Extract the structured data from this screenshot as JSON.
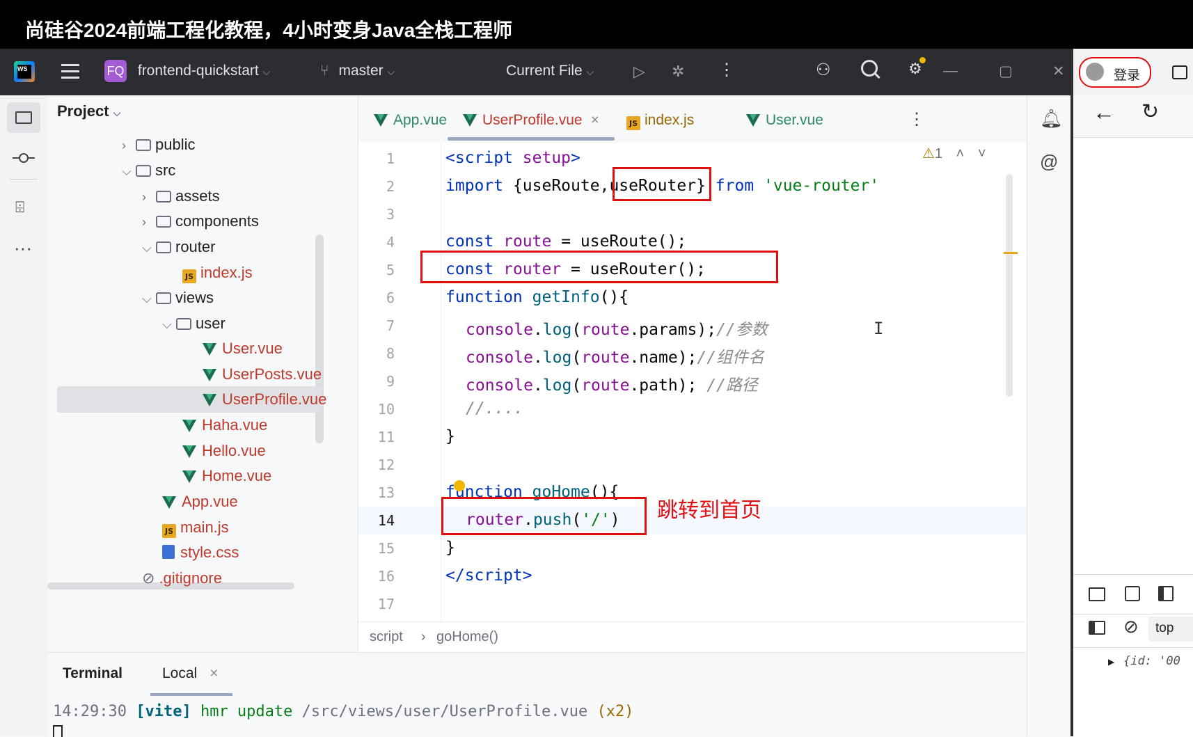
{
  "banner": {
    "title": "尚硅谷2024前端工程化教程，4小时变身Java全栈工程师"
  },
  "toolbar": {
    "project_badge": "FQ",
    "project_name": "frontend-quickstart",
    "branch": "master",
    "run_config": "Current File"
  },
  "project_panel": {
    "title": "Project",
    "tree": [
      {
        "label": "public",
        "kind": "folder",
        "expanded": false
      },
      {
        "label": "src",
        "kind": "folder",
        "expanded": true
      },
      {
        "label": "assets",
        "kind": "folder",
        "expanded": false
      },
      {
        "label": "components",
        "kind": "folder",
        "expanded": false
      },
      {
        "label": "router",
        "kind": "folder",
        "expanded": true
      },
      {
        "label": "index.js",
        "kind": "js"
      },
      {
        "label": "views",
        "kind": "folder",
        "expanded": true
      },
      {
        "label": "user",
        "kind": "folder",
        "expanded": true
      },
      {
        "label": "User.vue",
        "kind": "vue"
      },
      {
        "label": "UserPosts.vue",
        "kind": "vue"
      },
      {
        "label": "UserProfile.vue",
        "kind": "vue",
        "selected": true
      },
      {
        "label": "Haha.vue",
        "kind": "vue"
      },
      {
        "label": "Hello.vue",
        "kind": "vue"
      },
      {
        "label": "Home.vue",
        "kind": "vue"
      },
      {
        "label": "App.vue",
        "kind": "vue"
      },
      {
        "label": "main.js",
        "kind": "js"
      },
      {
        "label": "style.css",
        "kind": "css"
      },
      {
        "label": ".gitignore",
        "kind": "ignore"
      }
    ]
  },
  "tabs": [
    {
      "label": "App.vue",
      "kind": "vue",
      "active": false
    },
    {
      "label": "UserProfile.vue",
      "kind": "vue",
      "active": true,
      "close": "×"
    },
    {
      "label": "index.js",
      "kind": "js",
      "active": false
    },
    {
      "label": "User.vue",
      "kind": "vue",
      "active": false
    }
  ],
  "editor": {
    "warning_count": "1",
    "current_line": "14",
    "lines": [
      "1",
      "2",
      "3",
      "4",
      "5",
      "6",
      "7",
      "8",
      "9",
      "10",
      "11",
      "12",
      "13",
      "14",
      "15",
      "16",
      "17"
    ],
    "code": {
      "l1_a": "<script",
      "l1_b": " setup",
      "l1_c": ">",
      "l2_a": "import",
      "l2_b": " {useRoute",
      "l2_c": ",",
      "l2_d": "useRouter",
      "l2_e": "}",
      "l2_f": " from ",
      "l2_g": "'vue-router'",
      "l4_a": "const",
      "l4_b": " route",
      "l4_c": " = useRoute();",
      "l5_a": "const",
      "l5_b": " router",
      "l5_c": " = useRouter();",
      "l6_a": "function",
      "l6_b": " getInfo",
      "l6_c": "(){",
      "l7_a": "console",
      "l7_b": ".",
      "l7_c": "log",
      "l7_d": "(",
      "l7_e": "route",
      "l7_f": ".params);",
      "l7_g": "//参数",
      "l8_a": "console",
      "l8_b": ".",
      "l8_c": "log",
      "l8_d": "(",
      "l8_e": "route",
      "l8_f": ".name);",
      "l8_g": "//组件名",
      "l9_a": "console",
      "l9_b": ".",
      "l9_c": "log",
      "l9_d": "(",
      "l9_e": "route",
      "l9_f": ".path); ",
      "l9_g": "//路径",
      "l10": "//....",
      "l11": "}",
      "l13_a": "function",
      "l13_b": " goHome",
      "l13_c": "(){",
      "l14_a": "router",
      "l14_b": ".",
      "l14_c": "push",
      "l14_d": "(",
      "l14_e": "'/'",
      "l14_f": ")",
      "l15": "}",
      "l16_a": "</script",
      "l16_b": ">"
    },
    "annotation": "跳转到首页",
    "cursor_glyph": "I"
  },
  "breadcrumb": {
    "items": [
      "script",
      "goHome()"
    ],
    "separator": "›"
  },
  "terminal": {
    "tab_title": "Terminal",
    "session": "Local",
    "log_time": "14:29:30",
    "log_tag": "[vite]",
    "log_msg": "hmr update",
    "log_path": "/src/views/user/UserProfile.vue",
    "log_count": "(x2)"
  },
  "browser": {
    "login_label": "登录",
    "context": "top",
    "console_snippet": "{id: '00"
  },
  "colors": {
    "accent_red": "#e01010",
    "vue_green": "#3fb27f",
    "keyword_blue": "#0033b3",
    "toolbar_bg": "#2b2d30"
  }
}
